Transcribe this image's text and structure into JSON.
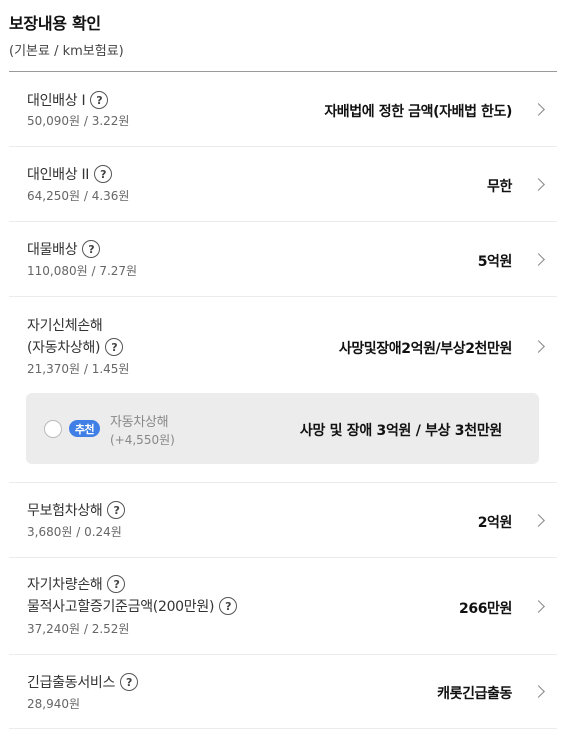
{
  "header": {
    "title": "보장내용 확인",
    "subtitle": "(기본료 / km보험료)"
  },
  "rows": [
    {
      "name": "대인배상 I",
      "price": "50,090원 / 3.22원",
      "value": "자배법에 정한 금액(자배법 한도)"
    },
    {
      "name": "대인배상 II",
      "price": "64,250원 / 4.36원",
      "value": "무한"
    },
    {
      "name": "대물배상",
      "price": "110,080원 / 7.27원",
      "value": "5억원"
    },
    {
      "name_line1": "자기신체손해",
      "name_line2": "(자동차상해)",
      "price": "21,370원 / 1.45원",
      "value": "사망및장애2억원/부상2천만원"
    },
    {
      "name": "무보험차상해",
      "price": "3,680원 / 0.24원",
      "value": "2억원"
    },
    {
      "name_line1": "자기차량손해",
      "name_line2": "물적사고할증기준금액(200만원)",
      "price": "37,240원 / 2.52원",
      "value": "266만원"
    },
    {
      "name": "긴급출동서비스",
      "price": "28,940원",
      "value": "캐롯긴급출동"
    }
  ],
  "recommendation": {
    "badge": "추천",
    "name": "자동차상해",
    "extra_price": "(+4,550원)",
    "value": "사망 및 장애 3억원 / 부상 3천만원"
  },
  "icons": {
    "help": "?"
  }
}
